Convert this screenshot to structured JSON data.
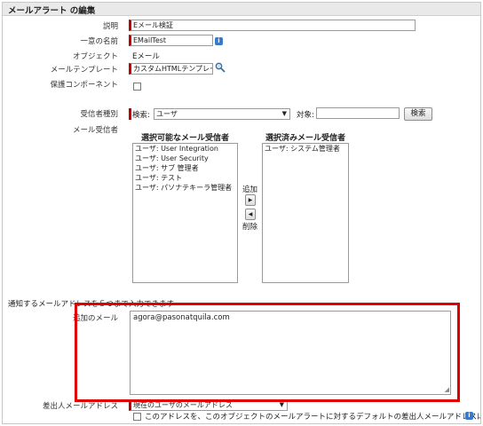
{
  "header": {
    "title": "メールアラート の編集"
  },
  "form": {
    "description": {
      "label": "説明",
      "value": "Eメール検証"
    },
    "unique_name": {
      "label": "一意の名前",
      "value": "EMailTest"
    },
    "object": {
      "label": "オブジェクト",
      "value": "Eメール"
    },
    "template": {
      "label": "メールテンプレート",
      "value": "カスタムHTMLテンプレート"
    },
    "protected": {
      "label": "保護コンポーネント",
      "checked": false
    }
  },
  "recipients": {
    "type_label": "受信者種別",
    "type_value": "ユーザ",
    "search_label": "検索:",
    "target_label": "対象:",
    "target_value": "",
    "search_button": "検索",
    "list_label": "メール受信者",
    "available_title": "選択可能なメール受信者",
    "available_items": [
      "ユーザ: User Integration",
      "ユーザ: User Security",
      "ユーザ: サブ 管理者",
      "ユーザ: テスト",
      "ユーザ: パソナテキーラ管理者"
    ],
    "selected_title": "選択済みメール受信者",
    "selected_items": [
      "ユーザ: システム管理者"
    ],
    "add_label": "追加",
    "remove_label": "削除"
  },
  "additional": {
    "note": "通知するメールアドレスを５つまで入力できます",
    "label": "追加のメール",
    "value": "agora@pasonatquila.com"
  },
  "sender": {
    "label": "差出人メールアドレス",
    "value": "現在のユーザのメールアドレス",
    "default_text": "このアドレスを、このオブジェクトのメールアラートに対するデフォルトの差出人メールアドレスにします。",
    "default_checked": false
  },
  "colors": {
    "required": "#c00000",
    "highlight": "#e00000",
    "header_bg": "#e9e9e9"
  }
}
